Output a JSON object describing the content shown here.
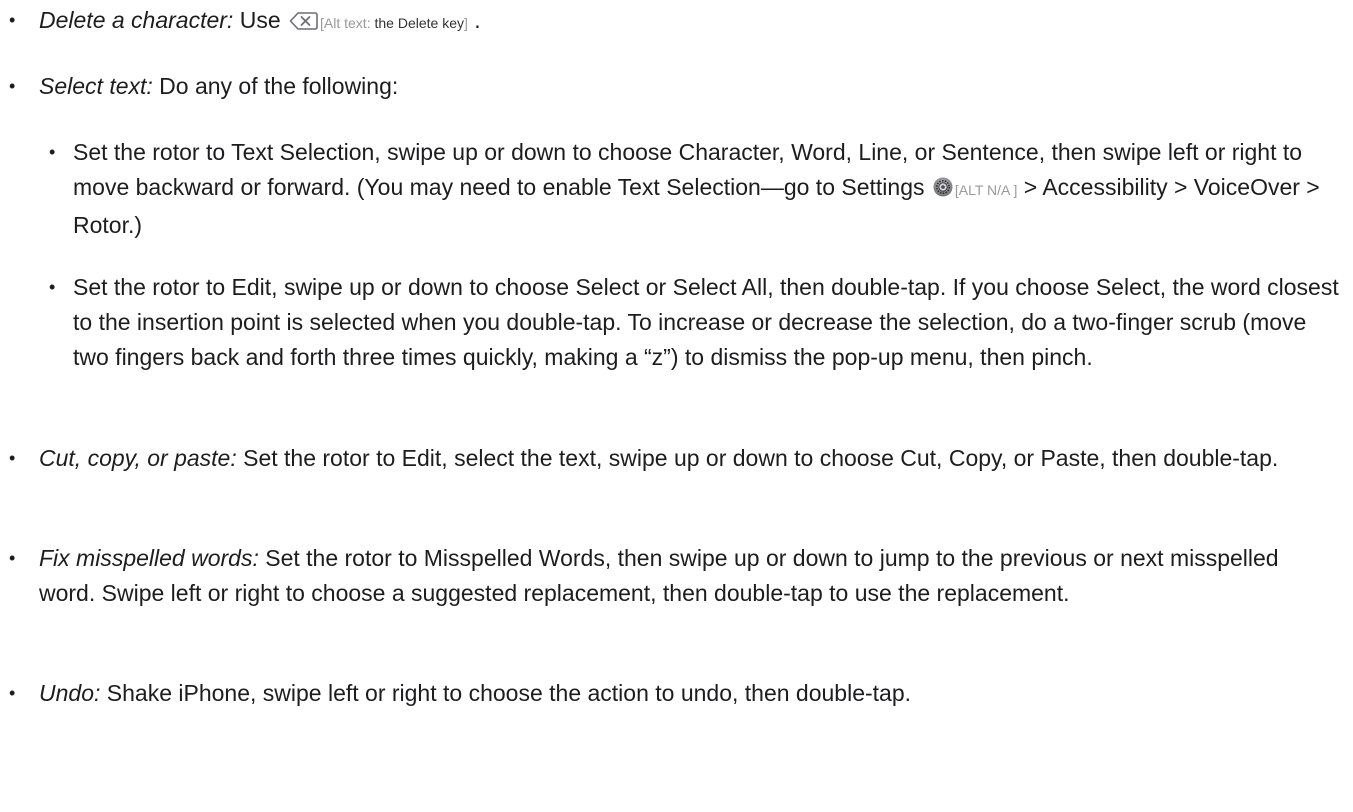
{
  "items": [
    {
      "label": "Delete a character:",
      "text_before": " Use ",
      "icon": "delete-key-icon",
      "alt_prefix": "[Alt text: ",
      "alt_value": "the Delete key",
      "alt_suffix": "]",
      "text_after": " ."
    },
    {
      "label": "Select text:",
      "text": " Do any of the following:"
    },
    {
      "text_before": "Set the rotor to Text Selection, swipe up or down to choose Character, Word, Line, or Sentence, then swipe left or right to move backward or forward. (You may need to enable Text Selection—go to Settings ",
      "icon": "settings-gear-icon",
      "alt": "[ALT N/A ]",
      "text_after": "  > Accessibility > VoiceOver > Rotor.)"
    },
    {
      "text": "Set the rotor to Edit, swipe up or down to choose Select or Select All, then double-tap. If you choose Select, the word closest to the insertion point is selected when you double-tap. To increase or decrease the selection, do a two-finger scrub (move two fingers back and forth three times quickly, making a “z”) to dismiss the pop-up menu, then pinch."
    },
    {
      "label": "Cut, copy, or paste:",
      "text": " Set the rotor to Edit, select the text, swipe up or down to choose Cut, Copy, or Paste, then double-tap."
    },
    {
      "label": "Fix misspelled words:",
      "text": " Set the rotor to Misspelled Words, then swipe up or down to jump to the previous or next misspelled word. Swipe left or right to choose a suggested replacement, then double-tap to use the replacement."
    },
    {
      "label": "Undo:",
      "text": " Shake iPhone, swipe left or right to choose the action to undo, then double-tap."
    }
  ],
  "bullet_glyph": "•"
}
